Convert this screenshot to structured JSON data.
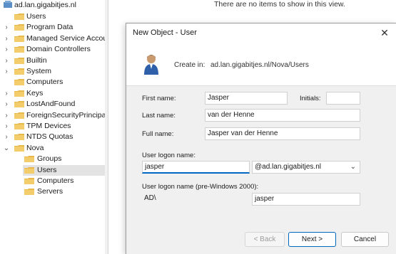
{
  "tree": {
    "root": "ad.lan.gigabitjes.nl",
    "items": [
      {
        "label": "Users",
        "chevron": ""
      },
      {
        "label": "Program Data",
        "chevron": "›"
      },
      {
        "label": "Managed Service Accour",
        "chevron": "›"
      },
      {
        "label": "Domain Controllers",
        "chevron": "›"
      },
      {
        "label": "Builtin",
        "chevron": "›"
      },
      {
        "label": "System",
        "chevron": "›"
      },
      {
        "label": "Computers",
        "chevron": ""
      },
      {
        "label": "Keys",
        "chevron": "›"
      },
      {
        "label": "LostAndFound",
        "chevron": "›"
      },
      {
        "label": "ForeignSecurityPrincipals",
        "chevron": "›"
      },
      {
        "label": "TPM Devices",
        "chevron": "›"
      },
      {
        "label": "NTDS Quotas",
        "chevron": "›"
      },
      {
        "label": "Nova",
        "chevron": "⌄"
      }
    ],
    "nova_children": [
      "Groups",
      "Users",
      "Computers",
      "Servers"
    ]
  },
  "right_pane": {
    "empty_message": "There are no items to show in this view."
  },
  "dialog": {
    "title": "New Object - User",
    "close_glyph": "✕",
    "create_in_label": "Create in:",
    "create_in_value": "ad.lan.gigabitjes.nl/Nova/Users",
    "first_name_label": "First name:",
    "first_name_value": "Jasper",
    "initials_label": "Initials:",
    "initials_value": "",
    "last_name_label": "Last name:",
    "last_name_value": "van der Henne",
    "full_name_label": "Full name:",
    "full_name_value": "Jasper van der Henne",
    "logon_label": "User logon name:",
    "logon_value": "jasper",
    "domain_value": "@ad.lan.gigabitjes.nl",
    "pre2000_label": "User logon name (pre-Windows 2000):",
    "pre2000_domain": "AD\\",
    "pre2000_value": "jasper",
    "back_label": "< Back",
    "next_label": "Next >",
    "cancel_label": "Cancel"
  },
  "colors": {
    "accent": "#0067c0",
    "folder": "#e8b84a"
  }
}
